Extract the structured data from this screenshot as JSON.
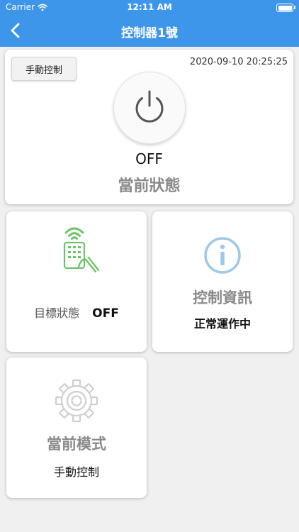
{
  "status_bar": {
    "carrier": "Carrier",
    "time": "12:11 AM"
  },
  "nav": {
    "title": "控制器1號"
  },
  "main_card": {
    "manual_button_label": "手動控制",
    "timestamp": "2020-09-10 20:25:25",
    "power_value": "OFF",
    "status_label": "當前狀態"
  },
  "target_card": {
    "label": "目標狀態",
    "value": "OFF"
  },
  "info_card": {
    "label": "控制資訊",
    "value": "正常運作中"
  },
  "mode_card": {
    "label": "當前模式",
    "value": "手動控制"
  },
  "colors": {
    "header": "#3d96ea",
    "background": "#f0f0f0",
    "remote_icon": "#6cc46a",
    "info_icon": "#9ec9e8",
    "gear_icon": "#cfcfcf",
    "muted_text": "#8a8a8a"
  },
  "icons": {
    "wifi": "wifi-icon",
    "battery": "battery-icon",
    "back": "chevron-left-icon",
    "power": "power-icon",
    "remote": "remote-control-icon",
    "info": "info-icon",
    "mode": "gear-icon"
  }
}
